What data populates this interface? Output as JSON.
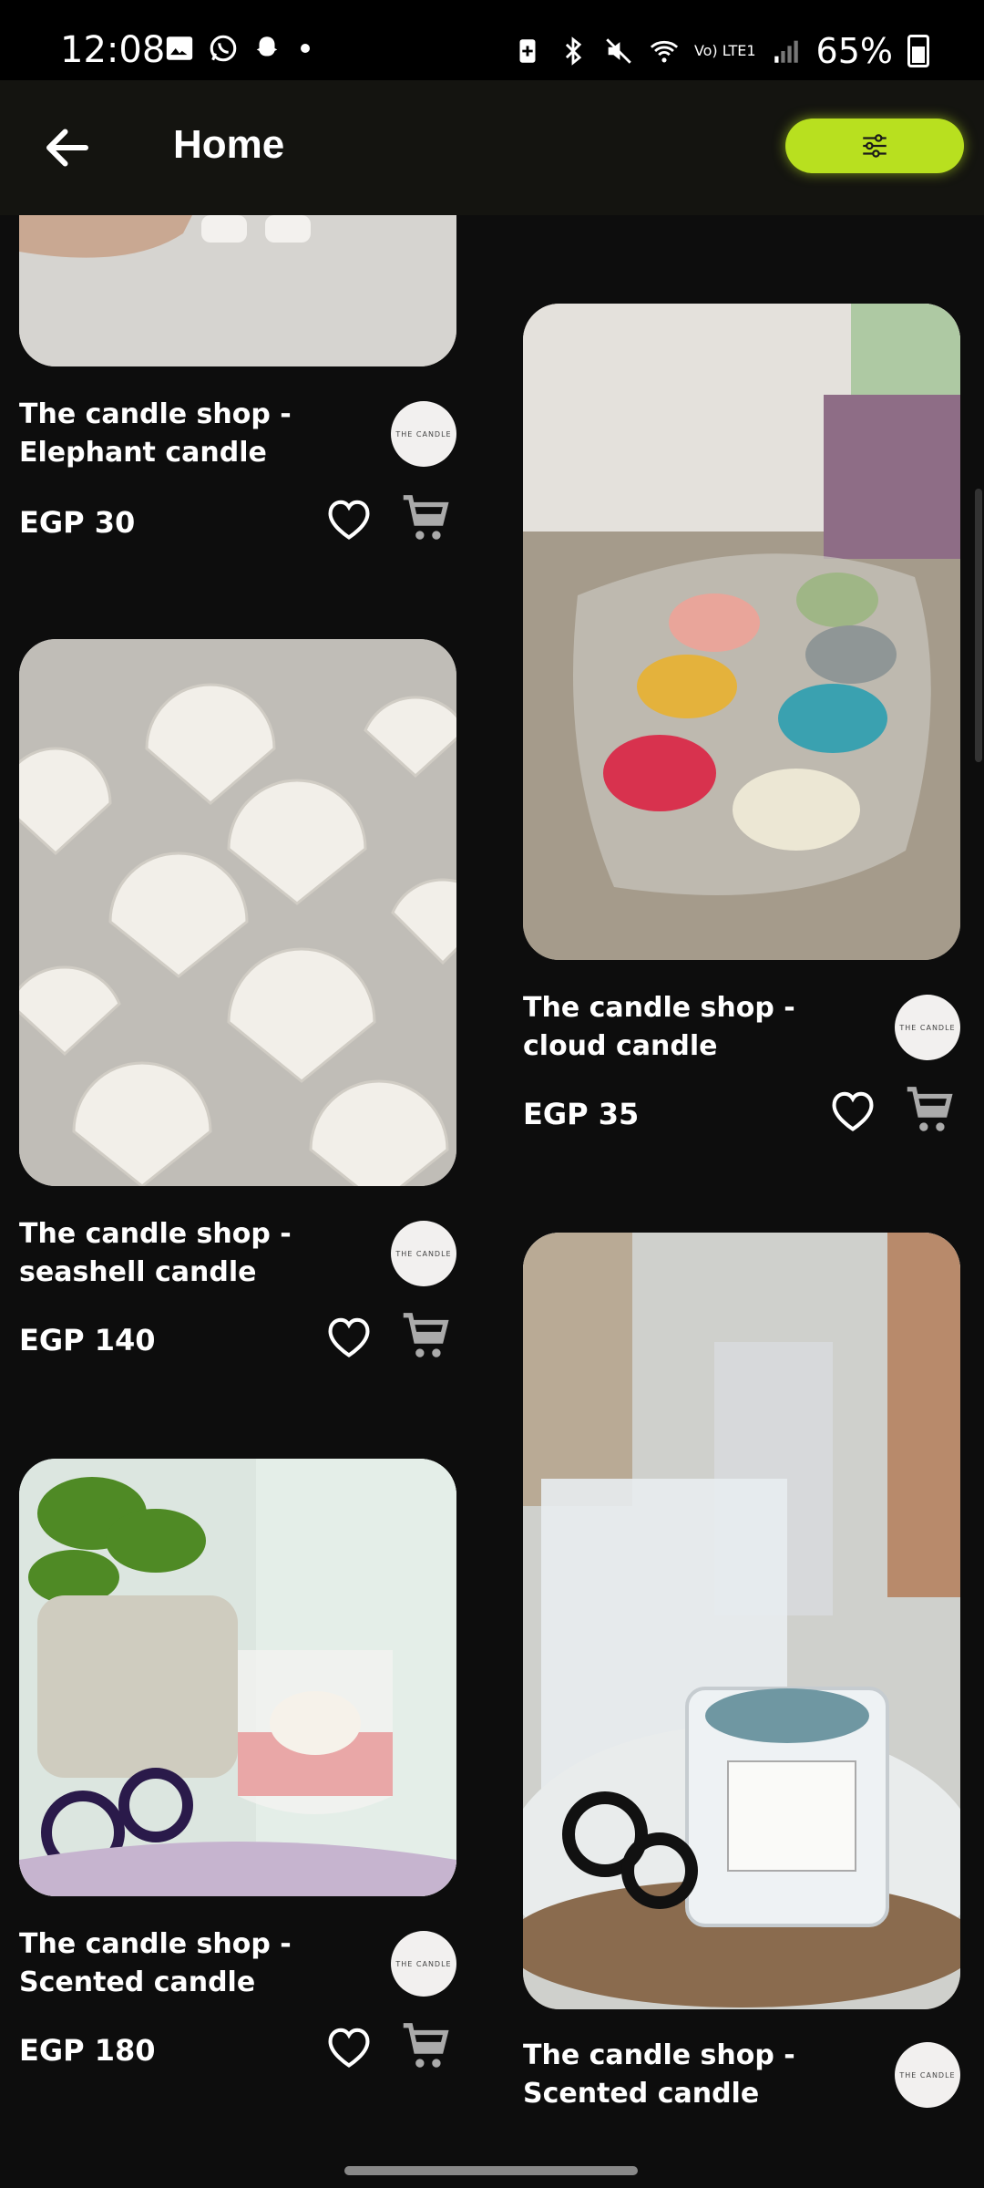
{
  "status_bar": {
    "time": "12:08",
    "battery": "65%",
    "network": "Vo) LTE1",
    "icons": [
      "gallery-icon",
      "whatsapp-icon",
      "snapchat-icon",
      "dot-icon",
      "battery-saver-icon",
      "bluetooth-icon",
      "mute-icon",
      "wifi-icon",
      "signal-icon",
      "battery-icon"
    ]
  },
  "app_bar": {
    "title": "Home",
    "back_icon": "arrow-left-icon",
    "filter_icon": "sliders-icon",
    "accent_color": "#b8e01f"
  },
  "products": [
    {
      "name": "The candle shop - Elephant candle",
      "price": "EGP 30",
      "column": "left"
    },
    {
      "name": "The candle shop - cloud candle",
      "price": "EGP 35",
      "column": "right"
    },
    {
      "name": "The candle shop - seashell candle",
      "price": "EGP 140",
      "column": "left"
    },
    {
      "name": "The candle shop - Scented candle",
      "price": "EGP 180",
      "column": "left"
    },
    {
      "name": "The candle shop - Scented candle",
      "price": "",
      "column": "right"
    }
  ],
  "icons": {
    "favorite": "heart-outline-icon",
    "cart": "cart-icon",
    "shop_logo": "shop-logo-icon"
  }
}
